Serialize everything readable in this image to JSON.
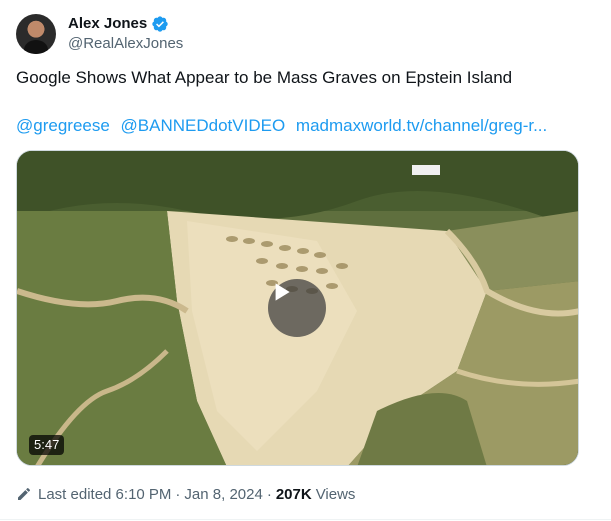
{
  "author": {
    "display_name": "Alex Jones",
    "handle": "@RealAlexJones",
    "verified_icon": "verified-badge-icon",
    "verified_color": "#1d9bf0"
  },
  "tweet": {
    "text": "Google Shows What Appear to be Mass Graves on Epstein Island",
    "links": [
      "@gregreese",
      "@BANNEDdotVIDEO",
      "madmaxworld.tv/channel/greg-r..."
    ]
  },
  "media": {
    "type": "video",
    "duration": "5:47",
    "play_icon": "play-icon"
  },
  "meta": {
    "edit_icon": "pencil-icon",
    "edited_label": "Last edited 6:10 PM",
    "separator": "·",
    "date": "Jan 8, 2024",
    "views_count": "207K",
    "views_label": "Views"
  },
  "colors": {
    "link": "#1d9bf0",
    "secondary_text": "#536471",
    "primary_text": "#0f1419"
  }
}
